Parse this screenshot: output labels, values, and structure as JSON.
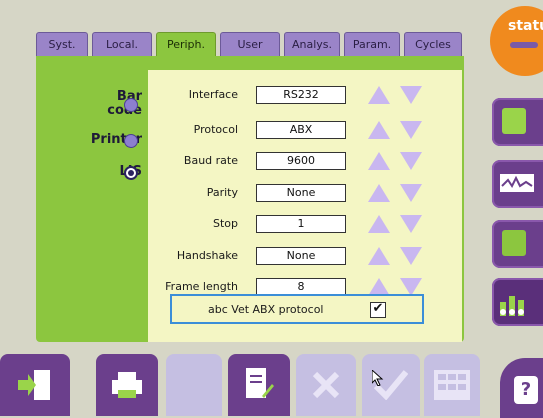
{
  "status": {
    "label": "statu"
  },
  "tabs": [
    {
      "label": "Syst."
    },
    {
      "label": "Local."
    },
    {
      "label": "Periph."
    },
    {
      "label": "User"
    },
    {
      "label": "Analys."
    },
    {
      "label": "Param."
    },
    {
      "label": "Cycles"
    }
  ],
  "devices": [
    {
      "label": "Bar code",
      "selected": false
    },
    {
      "label": "Printer",
      "selected": false
    },
    {
      "label": "LIS",
      "selected": true
    }
  ],
  "fields": [
    {
      "label": "Interface",
      "value": "RS232"
    },
    {
      "label": "Protocol",
      "value": "ABX"
    },
    {
      "label": "Baud rate",
      "value": "9600"
    },
    {
      "label": "Parity",
      "value": "None"
    },
    {
      "label": "Stop",
      "value": "1"
    },
    {
      "label": "Handshake",
      "value": "None"
    },
    {
      "label": "Frame length",
      "value": "8"
    }
  ],
  "protocol_option": {
    "label": "abc Vet ABX protocol",
    "checked": true,
    "check_glyph": "✔"
  },
  "side_buttons": [
    "map-icon",
    "waveform-icon",
    "document-icon",
    "settings-sliders-icon"
  ],
  "toolbar": [
    "exit-icon",
    "printer-icon",
    "blank-icon",
    "edit-document-icon",
    "close-icon",
    "validate-icon",
    "keypad-icon"
  ],
  "help": {
    "label": "?"
  }
}
